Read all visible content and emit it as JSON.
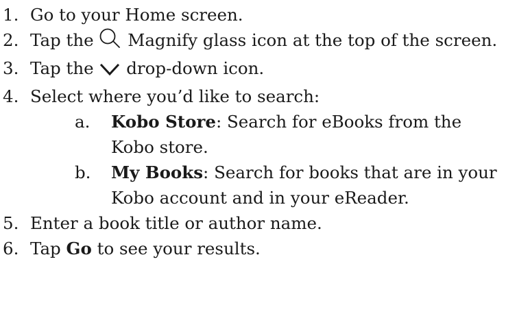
{
  "steps": [
    {
      "num": "1.",
      "text": "Go to your Home screen."
    },
    {
      "num": "2.",
      "pre": "Tap the",
      "icon": "magnify-glass-icon",
      "post": "Magnify glass icon at the top of the screen."
    },
    {
      "num": "3.",
      "pre": "Tap the",
      "icon": "chevron-down-icon",
      "post": "drop-down icon."
    },
    {
      "num": "4.",
      "text": "Select where you’d like to search:",
      "sub": [
        {
          "letter": "a.",
          "bold": "Kobo Store",
          "rest": ": Search for eBooks from the Kobo store."
        },
        {
          "letter": "b.",
          "bold": "My Books",
          "rest": ": Search for books that are in your Kobo account and in your eReader."
        }
      ]
    },
    {
      "num": "5.",
      "text": "Enter a book title or author name."
    },
    {
      "num": "6.",
      "pre": "Tap",
      "bold": "Go",
      "post": "to see your results."
    }
  ]
}
